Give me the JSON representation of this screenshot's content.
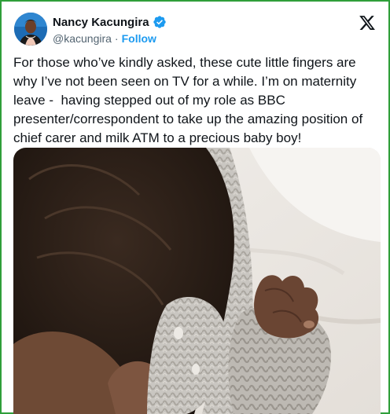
{
  "tweet": {
    "author_name": "Nancy Kacungira",
    "handle": "@kacungira",
    "separator": "·",
    "follow_label": "Follow",
    "text": "For those who’ve kindly asked, these cute little fingers are why I’ve not been seen on TV for a while. I’m on maternity leave -  having stepped out of my role as BBC presenter/correspondent to take up the amazing position of chief carer and milk ATM to a precious baby boy!"
  },
  "icons": {
    "verified": "verified-badge-icon",
    "platform": "x-logo-icon"
  },
  "colors": {
    "accent": "#1d9bf0",
    "text": "#0f1419",
    "muted": "#536471",
    "frame": "#2f9e3a"
  }
}
